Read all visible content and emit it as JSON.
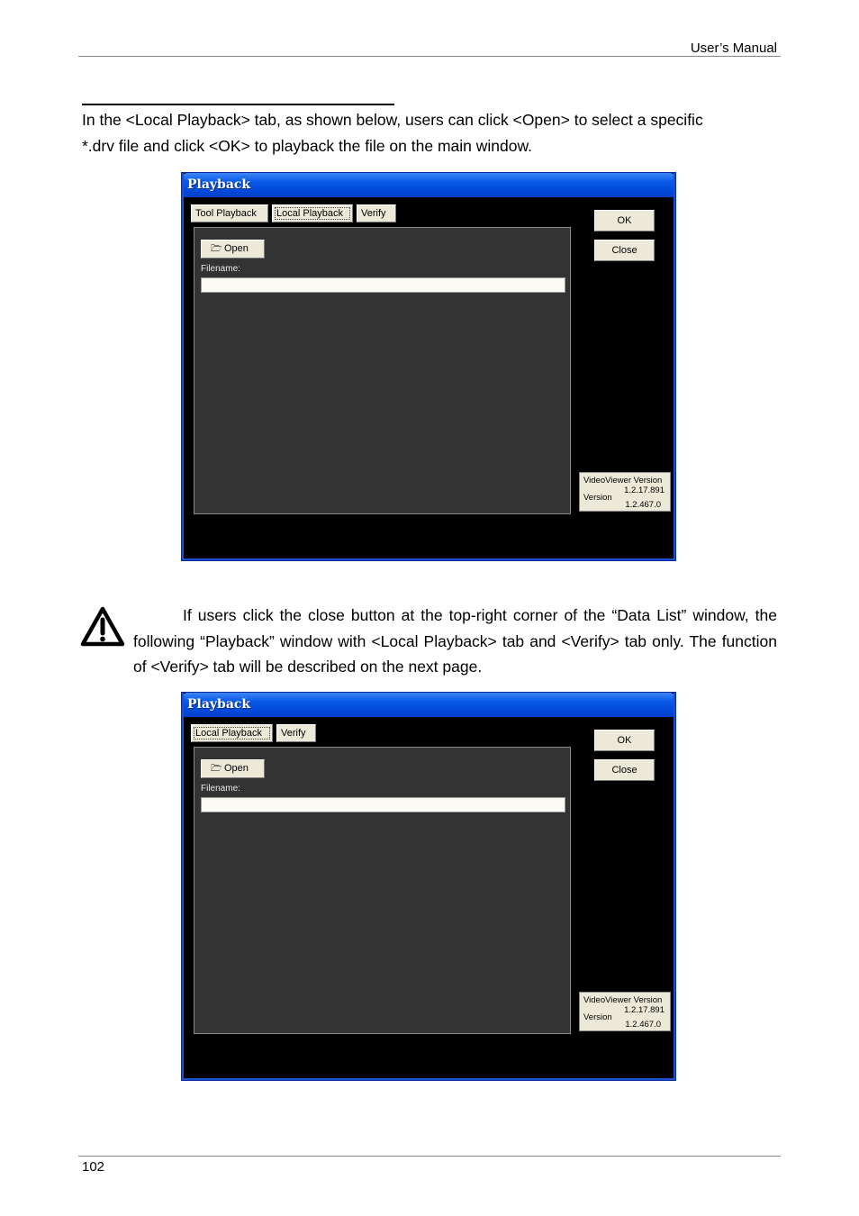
{
  "header": {
    "title": "User’s Manual"
  },
  "intro": {
    "line1": "In the <Local Playback> tab, as shown below, users can click <Open> to select a specific",
    "line2": "*.drv file and click <OK> to playback the file on the main window."
  },
  "note": {
    "text": "If users click the close button at the top-right corner of the “Data List” window, the following “Playback” window with <Local Playback> tab and <Verify> tab only. The function of <Verify> tab will be described on the next page.",
    "icon": "warning-icon"
  },
  "window1": {
    "title": "Playback",
    "tabs": [
      "Tool Playback",
      "Local Playback",
      "Verify"
    ],
    "active_tab": "Local Playback",
    "open_label": "Open",
    "filename_label": "Filename:",
    "filename_value": "",
    "ok_label": "OK",
    "close_label": "Close",
    "version": {
      "viewer_label": "VideoViewer Version",
      "viewer_value": "1.2.17.891",
      "version_label": "Version",
      "version_value": "1.2.467.0"
    }
  },
  "window2": {
    "title": "Playback",
    "tabs": [
      "Local Playback",
      "Verify"
    ],
    "active_tab": "Local Playback",
    "open_label": "Open",
    "filename_label": "Filename:",
    "filename_value": "",
    "ok_label": "OK",
    "close_label": "Close",
    "version": {
      "viewer_label": "VideoViewer Version",
      "viewer_value": "1.2.17.891",
      "version_label": "Version",
      "version_value": "1.2.467.0"
    }
  },
  "footer": {
    "page_number": "102"
  },
  "colors": {
    "title_bar": "#0a5ae8",
    "window_bg": "#000000",
    "panel_bg": "#333333",
    "button_face": "#ece9d8"
  }
}
